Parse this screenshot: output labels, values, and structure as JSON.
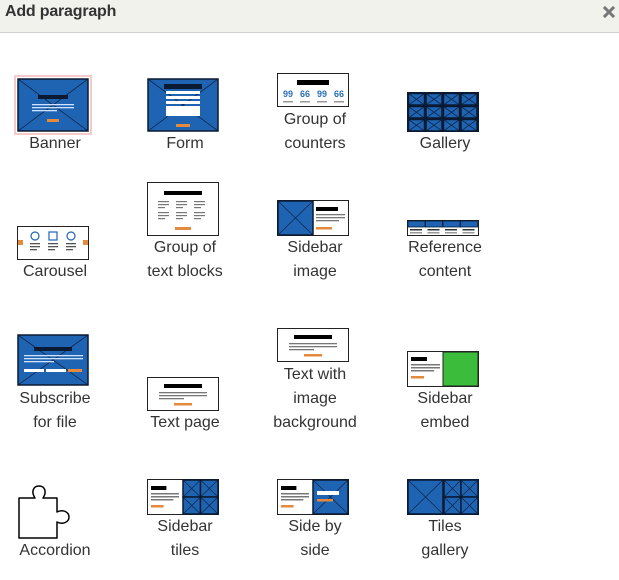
{
  "dialog": {
    "title": "Add paragraph",
    "close_icon": "close-icon"
  },
  "colors": {
    "blue": "#1f64b3",
    "dark": "#0b1a33",
    "orange": "#e5893d",
    "green": "#3bbd3b",
    "selected_border": "#f5caca",
    "counter_blue": "#2a6fb8"
  },
  "items": [
    {
      "key": "banner",
      "label_lines": [
        "Banner"
      ],
      "selected": true
    },
    {
      "key": "form",
      "label_lines": [
        "Form"
      ]
    },
    {
      "key": "group-of-counters",
      "label_lines": [
        "Group of",
        "counters"
      ],
      "counter_values": [
        "99",
        "66",
        "99",
        "66"
      ]
    },
    {
      "key": "gallery",
      "label_lines": [
        "Gallery"
      ]
    },
    {
      "key": "carousel",
      "label_lines": [
        "Carousel"
      ]
    },
    {
      "key": "group-of-text-blocks",
      "label_lines": [
        "Group of",
        "text blocks"
      ]
    },
    {
      "key": "sidebar-image",
      "label_lines": [
        "Sidebar",
        "image"
      ]
    },
    {
      "key": "reference-content",
      "label_lines": [
        "Reference",
        "content"
      ]
    },
    {
      "key": "subscribe-for-file",
      "label_lines": [
        "Subscribe",
        "for file"
      ]
    },
    {
      "key": "text-page",
      "label_lines": [
        "Text page"
      ]
    },
    {
      "key": "text-with-image-background",
      "label_lines": [
        "Text with",
        "image",
        "background"
      ]
    },
    {
      "key": "sidebar-embed",
      "label_lines": [
        "Sidebar",
        "embed"
      ],
      "embed_glyph": "</>"
    },
    {
      "key": "accordion",
      "label_lines": [
        "Accordion"
      ]
    },
    {
      "key": "sidebar-tiles",
      "label_lines": [
        "Sidebar",
        "tiles"
      ]
    },
    {
      "key": "side-by-side",
      "label_lines": [
        "Side by",
        "side"
      ]
    },
    {
      "key": "tiles-gallery",
      "label_lines": [
        "Tiles",
        "gallery"
      ]
    }
  ]
}
